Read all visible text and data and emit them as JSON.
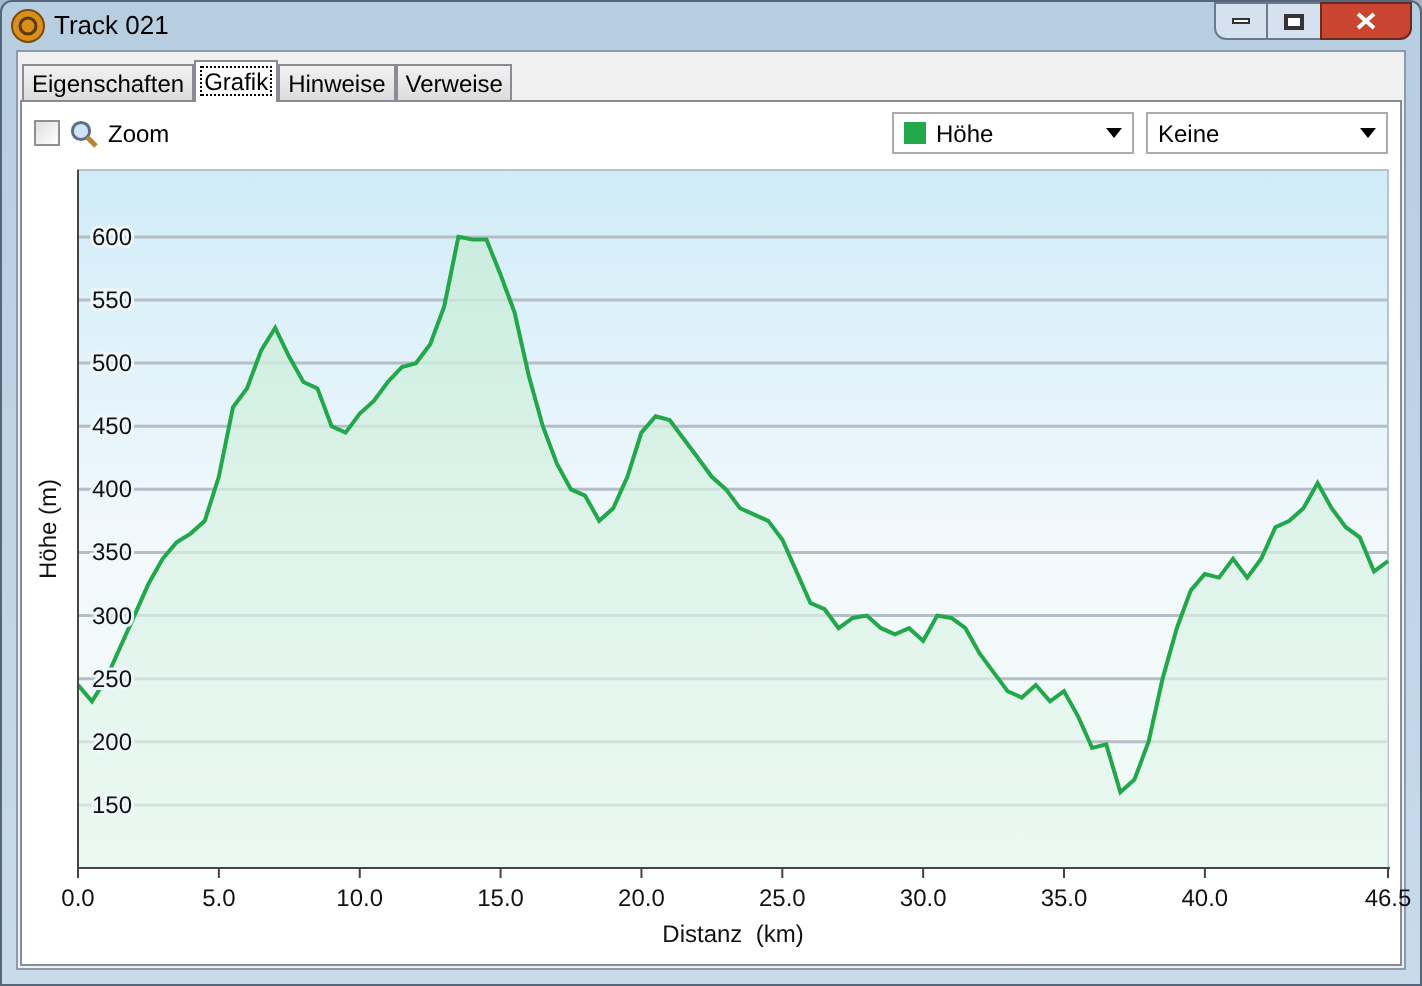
{
  "window": {
    "title": "Track 021"
  },
  "tabs": [
    {
      "label": "Eigenschaften",
      "selected": false
    },
    {
      "label": "Grafik",
      "selected": true
    },
    {
      "label": "Hinweise",
      "selected": false
    },
    {
      "label": "Verweise",
      "selected": false
    }
  ],
  "toolbar": {
    "zoom": {
      "label": "Zoom",
      "checked": false
    },
    "dropdowns": [
      {
        "value": "Höhe",
        "color": "#22a84a"
      },
      {
        "value": "Keine"
      }
    ]
  },
  "chart_data": {
    "type": "area",
    "grid": true,
    "xlabel": "Distanz  (km)",
    "ylabel": "Höhe (m)",
    "xlim": [
      0,
      46.5
    ],
    "ylim": [
      100,
      653
    ],
    "xticks": [
      {
        "value": 0,
        "label": "0.0"
      },
      {
        "value": 5,
        "label": "5.0"
      },
      {
        "value": 10,
        "label": "10.0"
      },
      {
        "value": 15,
        "label": "15.0"
      },
      {
        "value": 20,
        "label": "20.0"
      },
      {
        "value": 25,
        "label": "25.0"
      },
      {
        "value": 30,
        "label": "30.0"
      },
      {
        "value": 35,
        "label": "35.0"
      },
      {
        "value": 40,
        "label": "40.0"
      },
      {
        "value": 46.5,
        "label": "46.5"
      }
    ],
    "yticks": [
      150,
      200,
      250,
      300,
      350,
      400,
      450,
      500,
      550,
      600
    ],
    "x": [
      0,
      0.5,
      1,
      1.5,
      2,
      2.5,
      3,
      3.5,
      4,
      4.5,
      5,
      5.5,
      6,
      6.5,
      7,
      7.5,
      8,
      8.5,
      9,
      9.5,
      10,
      10.5,
      11,
      11.5,
      12,
      12.5,
      13,
      13.5,
      14,
      14.5,
      15,
      15.5,
      16,
      16.5,
      17,
      17.5,
      18,
      18.5,
      19,
      19.5,
      20,
      20.5,
      21,
      21.5,
      22,
      22.5,
      23,
      23.5,
      24,
      24.5,
      25,
      25.5,
      26,
      26.5,
      27,
      27.5,
      28,
      28.5,
      29,
      29.5,
      30,
      30.5,
      31,
      31.5,
      32,
      32.5,
      33,
      33.5,
      34,
      34.5,
      35,
      35.5,
      36,
      36.5,
      37,
      37.5,
      38,
      38.5,
      39,
      39.5,
      40,
      40.5,
      41,
      41.5,
      42,
      42.5,
      43,
      43.5,
      44,
      44.5,
      45,
      45.5,
      46,
      46.5
    ],
    "series": [
      {
        "color": "#22a84a",
        "values": [
          245,
          232,
          250,
          275,
          300,
          325,
          345,
          358,
          365,
          375,
          410,
          465,
          480,
          510,
          528,
          505,
          485,
          480,
          450,
          445,
          460,
          470,
          485,
          497,
          500,
          515,
          545,
          600,
          598,
          598,
          570,
          540,
          490,
          450,
          420,
          400,
          395,
          375,
          385,
          410,
          445,
          458,
          455,
          440,
          425,
          410,
          400,
          385,
          380,
          375,
          360,
          335,
          310,
          305,
          290,
          298,
          300,
          290,
          285,
          290,
          280,
          300,
          298,
          290,
          270,
          255,
          240,
          235,
          245,
          232,
          240,
          220,
          195,
          198,
          160,
          170,
          200,
          250,
          290,
          320,
          333,
          330,
          345,
          330,
          345,
          370,
          375,
          385,
          405,
          385,
          370,
          362,
          335,
          343
        ]
      }
    ]
  }
}
